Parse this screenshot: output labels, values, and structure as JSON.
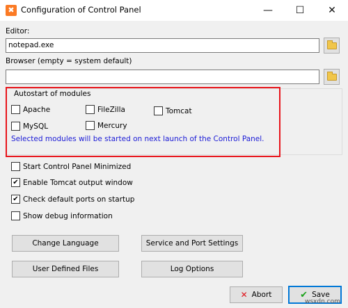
{
  "window": {
    "title": "Configuration of Control Panel",
    "app_icon_glyph": "✖",
    "minimize_glyph": "—",
    "maximize_glyph": "☐",
    "close_glyph": "✕"
  },
  "editor": {
    "label": "Editor:",
    "value": "notepad.exe"
  },
  "browser": {
    "label": "Browser (empty = system default)",
    "value": ""
  },
  "autostart": {
    "title": "Autostart of modules",
    "modules": [
      {
        "label": "Apache",
        "checked": false
      },
      {
        "label": "FileZilla",
        "checked": false
      },
      {
        "label": "Tomcat",
        "checked": false
      },
      {
        "label": "MySQL",
        "checked": false
      },
      {
        "label": "Mercury",
        "checked": false
      }
    ],
    "notice": "Selected modules will be started on next launch of the Control Panel.",
    "highlight_color": "#e8141b"
  },
  "options": [
    {
      "label": "Start Control Panel Minimized",
      "checked": false
    },
    {
      "label": "Enable Tomcat output window",
      "checked": true
    },
    {
      "label": "Check default ports on startup",
      "checked": true
    },
    {
      "label": "Show debug information",
      "checked": false
    }
  ],
  "buttons": {
    "change_language": "Change Language",
    "service_port_settings": "Service and Port Settings",
    "user_defined_files": "User Defined Files",
    "log_options": "Log Options",
    "abort": "Abort",
    "save": "Save"
  },
  "check_glyph": "✔",
  "watermark": "wsxdn.com"
}
